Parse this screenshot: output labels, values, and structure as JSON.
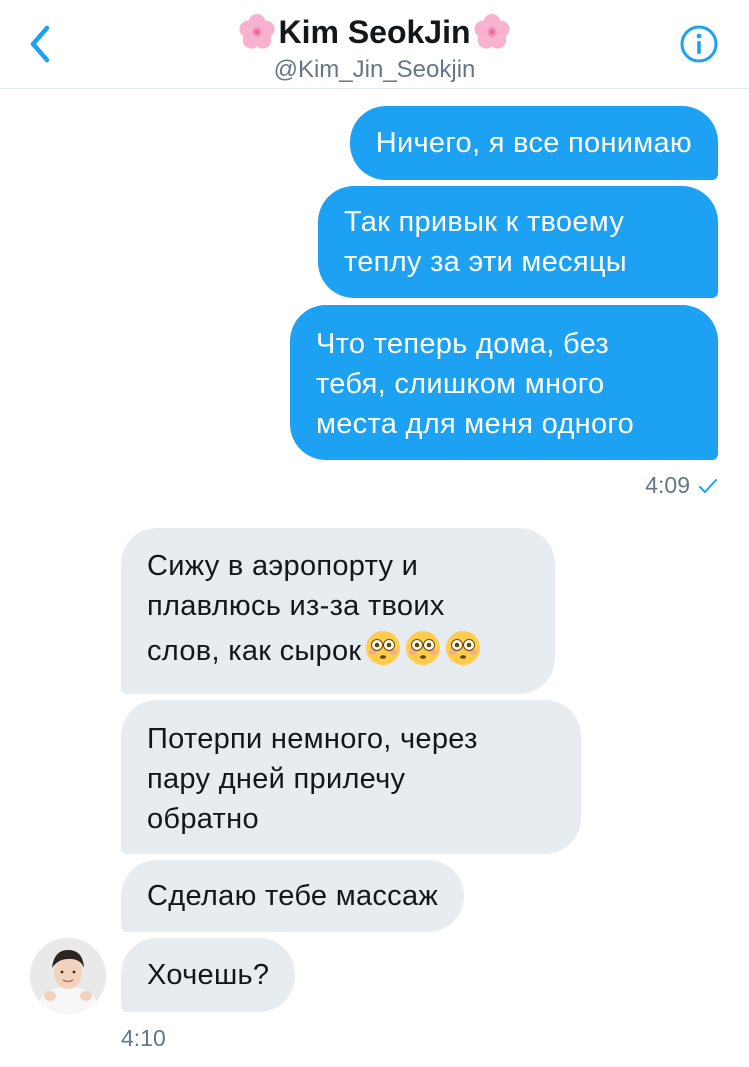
{
  "header": {
    "contact_name": "Kim SeokJin",
    "contact_handle": "@Kim_Jin_Seokjin",
    "left_emoji": "cherry-blossom-icon",
    "right_emoji": "cherry-blossom-icon",
    "back_icon": "chevron-left-icon",
    "info_icon": "info-icon"
  },
  "colors": {
    "accent": "#1da1f2",
    "incoming_bubble": "#e6ecf0",
    "text_dark": "#14171a",
    "text_muted": "#657786"
  },
  "messages": {
    "outgoing": [
      {
        "lines": [
          "Ничего, я все понимаю"
        ]
      },
      {
        "lines": [
          "Так привык к твоему",
          "теплу за эти месяцы"
        ]
      },
      {
        "lines": [
          "Что теперь дома, без",
          "тебя, слишком много",
          "места для меня одного"
        ]
      }
    ],
    "outgoing_time": "4:09",
    "outgoing_status_icon": "checkmark-icon",
    "incoming": [
      {
        "lines": [
          "Сижу в аэропорту и",
          "плавлюсь из-за твоих",
          "слов, как сырок"
        ],
        "emoji": [
          "flushed-face-icon",
          "flushed-face-icon",
          "flushed-face-icon"
        ]
      },
      {
        "lines": [
          "Потерпи немного, через",
          "пару дней прилечу",
          "обратно"
        ]
      },
      {
        "lines": [
          "Сделаю тебе массаж"
        ]
      },
      {
        "lines": [
          "Хочешь?"
        ]
      }
    ],
    "incoming_time": "4:10"
  }
}
